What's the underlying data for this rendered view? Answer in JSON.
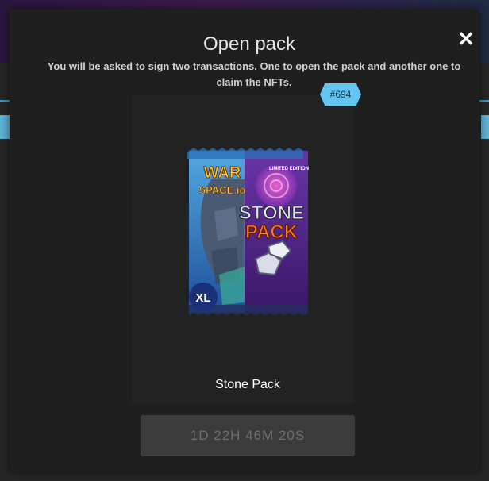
{
  "modal": {
    "title": "Open pack",
    "subtitle": "You will be asked to sign two transactions. One to open the pack and another one to claim the NFTs.",
    "close_glyph": "✕",
    "pack": {
      "id_badge": "#694",
      "name": "Stone Pack",
      "art": {
        "logo_line1": "WAR",
        "logo_line2": "SPACE.io",
        "edition": "LIMITED EDITION",
        "title_line1": "STONE",
        "title_line2": "PACK",
        "size": "XL"
      }
    },
    "timer_label": "1D 22H 46M 20S"
  },
  "colors": {
    "modal_bg": "#1f1f1f",
    "badge": "#63c6f2",
    "button_bg": "#3b3b3b",
    "button_text": "#6e6e6e",
    "pack_left": "#3f7fc8",
    "pack_right": "#5a2b8a"
  },
  "icons": {
    "close": "close-icon"
  }
}
